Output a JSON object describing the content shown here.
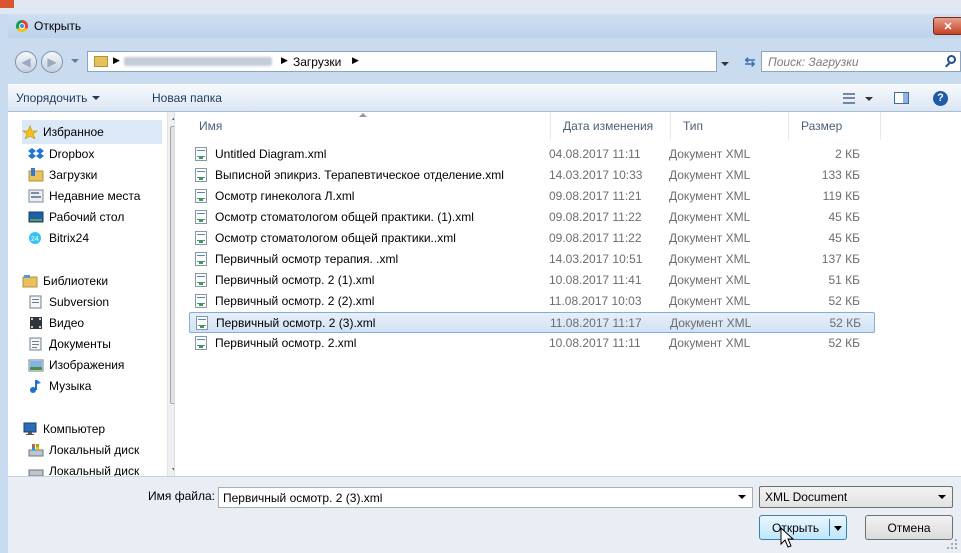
{
  "window": {
    "title": "Открыть",
    "close_glyph": "✕"
  },
  "address": {
    "breadcrumb": [
      "Загрузки"
    ],
    "search_placeholder": "Поиск: Загрузки"
  },
  "toolbar": {
    "organize": "Упорядочить",
    "new_folder": "Новая папка",
    "help": "?"
  },
  "nav": {
    "favorites": {
      "label": "Избранное",
      "items": [
        "Dropbox",
        "Загрузки",
        "Недавние места",
        "Рабочий стол",
        "Bitrix24"
      ]
    },
    "libraries": {
      "label": "Библиотеки",
      "items": [
        "Subversion",
        "Видео",
        "Документы",
        "Изображения",
        "Музыка"
      ]
    },
    "computer": {
      "label": "Компьютер",
      "items": [
        "Локальный диск",
        "Локальный диск"
      ]
    }
  },
  "columns": {
    "name": "Имя",
    "date": "Дата изменения",
    "type": "Тип",
    "size": "Размер"
  },
  "files": [
    {
      "name": "Untitled Diagram.xml",
      "date": "04.08.2017 11:11",
      "type": "Документ XML",
      "size": "2 КБ"
    },
    {
      "name": "Выписной эпикриз. Терапевтическое отделение.xml",
      "date": "14.03.2017 10:33",
      "type": "Документ XML",
      "size": "133 КБ"
    },
    {
      "name": "Осмотр гинеколога Л.xml",
      "date": "09.08.2017 11:21",
      "type": "Документ XML",
      "size": "119 КБ"
    },
    {
      "name": "Осмотр стоматологом общей практики. (1).xml",
      "date": "09.08.2017 11:22",
      "type": "Документ XML",
      "size": "45 КБ"
    },
    {
      "name": "Осмотр стоматологом общей практики..xml",
      "date": "09.08.2017 11:22",
      "type": "Документ XML",
      "size": "45 КБ"
    },
    {
      "name": "Первичный осмотр терапия. .xml",
      "date": "14.03.2017 10:51",
      "type": "Документ XML",
      "size": "137 КБ"
    },
    {
      "name": "Первичный осмотр. 2 (1).xml",
      "date": "10.08.2017 11:41",
      "type": "Документ XML",
      "size": "51 КБ"
    },
    {
      "name": "Первичный осмотр. 2 (2).xml",
      "date": "11.08.2017 10:03",
      "type": "Документ XML",
      "size": "52 КБ"
    },
    {
      "name": "Первичный осмотр. 2 (3).xml",
      "date": "11.08.2017 11:17",
      "type": "Документ XML",
      "size": "52 КБ",
      "selected": true
    },
    {
      "name": "Первичный осмотр. 2.xml",
      "date": "10.08.2017 11:11",
      "type": "Документ XML",
      "size": "52 КБ"
    }
  ],
  "bottom": {
    "filename_label": "Имя файла:",
    "filename_value": "Первичный осмотр. 2 (3).xml",
    "filetype": "XML Document",
    "open": "Открыть",
    "cancel": "Отмена"
  }
}
